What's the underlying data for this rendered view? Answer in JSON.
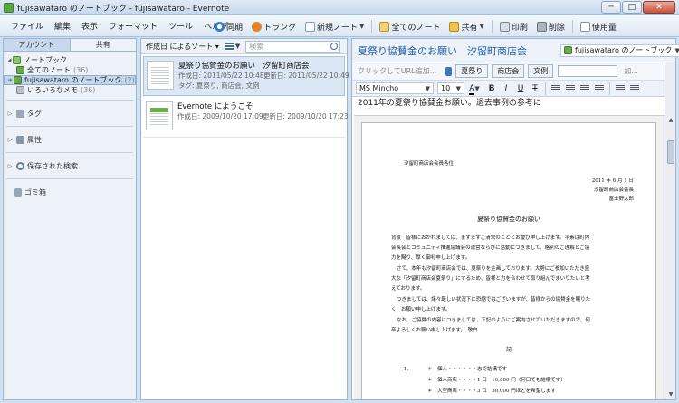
{
  "window": {
    "title": "fujisawataro のノートブック - fujisawataro - Evernote",
    "minimize": "─",
    "maximize": "□",
    "close": "✕"
  },
  "menu": [
    "ファイル",
    "編集",
    "表示",
    "フォーマット",
    "ツール",
    "ヘルプ"
  ],
  "toolbar": {
    "sync": "同期",
    "trunk": "トランク",
    "new_note": "新規ノート",
    "all_notes": "全てのノート",
    "share": "共有",
    "print": "印刷",
    "delete": "削除",
    "usage": "使用量"
  },
  "sidebar": {
    "tab_account": "アカウント",
    "tab_shared": "共有",
    "notebooks_label": "ノートブック",
    "items": [
      {
        "label": "全てのノート",
        "count": "(36)"
      },
      {
        "label": "fujisawataro のノートブック",
        "count": "(2)"
      },
      {
        "label": "いろいろなメモ",
        "count": "(36)"
      }
    ],
    "tags": "タグ",
    "attributes": "属性",
    "saved_search": "保存された検索",
    "trash": "ゴミ箱"
  },
  "note_list": {
    "sort_label": "作成日 によるソート ▾",
    "search_placeholder": "検索",
    "notes": [
      {
        "title": "夏祭り協賛金のお願い　汐留町商店会",
        "created": "作成日: 2011/05/22 10:48",
        "updated": "更新日: 2011/05/22 10:49",
        "tags": "タグ: 夏祭り, 商店会, 文例"
      },
      {
        "title": "Evernote にようこそ",
        "created": "作成日: 2009/10/20 17:09",
        "updated": "更新日: 2009/10/20 17:23",
        "tags": ""
      }
    ]
  },
  "editor": {
    "title": "夏祭り協賛金のお願い　汐留町商店会",
    "notebook": "fujisawataro のノートブック",
    "url_placeholder": "クリックしてURL追加...",
    "tags": [
      "夏祭り",
      "商店会",
      "文例"
    ],
    "tag_add": "加...",
    "font": "MS Mincho",
    "font_size": "10",
    "first_line": "2011年の夏祭り協賛金お願い。過去事例の参考に"
  },
  "document": {
    "addressee": "汐留町商店会会員各位",
    "date": "2011 年 6 月 1 日",
    "sender_org": "汐留町商店会会長",
    "sender_name": "富士野太郎",
    "heading": "夏祭り協賛金のお願い",
    "p1a": "背景　皆様におかれましては、ますますご清栄のこととお慶び申し上げます。平素は町内",
    "p1b": "会長会とコミュニティ推進協議会の運営ならびに活動につきまして、格別のご理解とご協",
    "p1c": "力を賜り、厚く御礼申し上げます。",
    "p2a": "さて、本年も汐留町商店会では、夏祭りを企画しております。大勢にご参加いただき盛",
    "p2b": "大な「汐留町商店会夏祭り」にするため、皆様と力を合わせて取り組んでまいりたいと考",
    "p2c": "えております。",
    "p3a": "つきましては、諸々厳しい状況下に恐縮ではございますが、皆様からの協賛金を賜りた",
    "p3b": "く、お願い申し上げます。",
    "p4a": "なお、ご協賛の内容につきましては、下記のようにご案内させていただきますので、何",
    "p4b": "卒よろしくお願い申し上げます。　敬白",
    "ki": "記",
    "item_num": "1．",
    "item1": "＊　個人・・・・・・志で結構です",
    "item2": "＊　個人商店・・・・1 口　10,000 円（何口でも結構です）",
    "item3": "＊　大型商店・・・・3 口　30,000 円ほどを希望します"
  }
}
